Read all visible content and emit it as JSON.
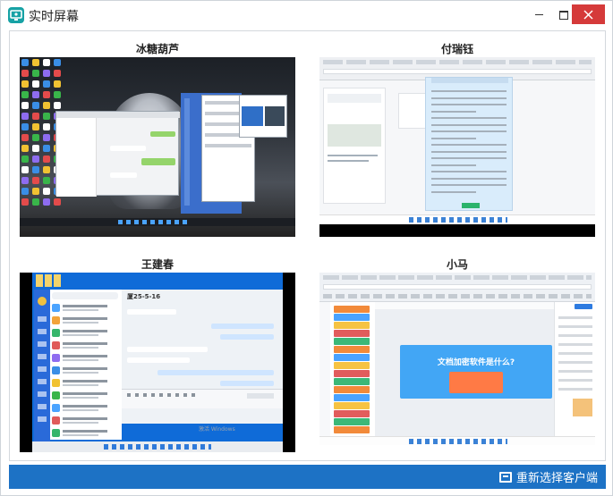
{
  "window": {
    "title": "实时屏幕",
    "accent": "#1d72c5",
    "close_color": "#d53a3a"
  },
  "tiles": [
    {
      "name": "冰糖葫芦"
    },
    {
      "name": "付瑞钰"
    },
    {
      "name": "王建春"
    },
    {
      "name": "小马"
    }
  ],
  "screen3": {
    "chat_title": "厦25-5-16",
    "watermark": "激活 Windows"
  },
  "screen4": {
    "headline": "文档加密软件是什么?"
  },
  "footer": {
    "reselect_label": "重新选择客户端"
  },
  "icons": {
    "app": "screen-share-icon",
    "reselect": "monitor-icon"
  }
}
